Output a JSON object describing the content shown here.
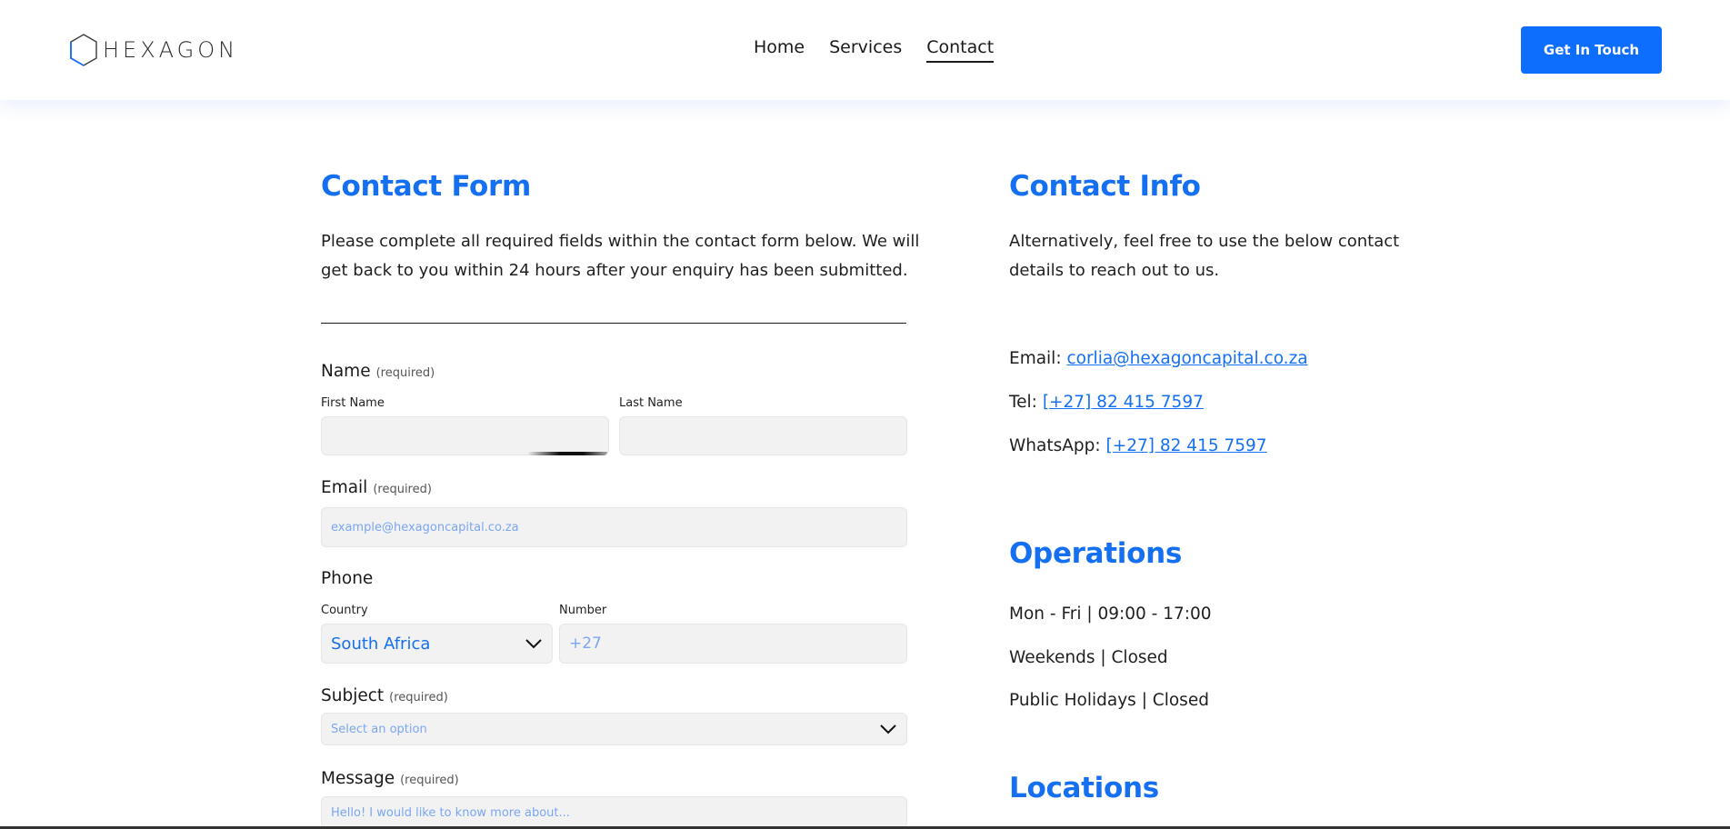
{
  "brand": {
    "name": "HEXAGON"
  },
  "nav": {
    "items": [
      {
        "label": "Home"
      },
      {
        "label": "Services"
      },
      {
        "label": "Contact"
      }
    ],
    "cta_label": "Get In Touch"
  },
  "form": {
    "title": "Contact Form",
    "intro_line1": "Please complete all required fields within the contact form below. We will",
    "intro_line2": "get back to you within 24 hours after your enquiry has been submitted.",
    "required_tag": "(required)",
    "name": {
      "label": "Name",
      "first_label": "First Name",
      "last_label": "Last Name",
      "first_value": "",
      "last_value": ""
    },
    "email": {
      "label": "Email",
      "placeholder": "example@hexagoncapital.co.za"
    },
    "phone": {
      "label": "Phone",
      "country_label": "Country",
      "country_value": "South Africa",
      "number_label": "Number",
      "number_placeholder": "+27"
    },
    "subject": {
      "label": "Subject",
      "placeholder": "Select an option"
    },
    "message": {
      "label": "Message",
      "placeholder": "Hello! I would like to know more about..."
    }
  },
  "info": {
    "title": "Contact Info",
    "intro_line1": "Alternatively, feel free to use the below contact",
    "intro_line2": "details to reach out to us.",
    "email_label": "Email:",
    "email_value": "corlia@hexagoncapital.co.za",
    "tel_label": "Tel:",
    "tel_value": "[+27] 82 415 7597",
    "whatsapp_label": "WhatsApp:",
    "whatsapp_value": "[+27] 82 415 7597"
  },
  "operations": {
    "title": "Operations",
    "lines": [
      "Mon - Fri | 09:00 - 17:00",
      "Weekends | Closed",
      "Public Holidays | Closed"
    ]
  },
  "locations": {
    "title": "Locations"
  },
  "colors": {
    "accent": "#1470f0",
    "cta": "#0d6efd",
    "field_bg": "#f2f2f2"
  }
}
